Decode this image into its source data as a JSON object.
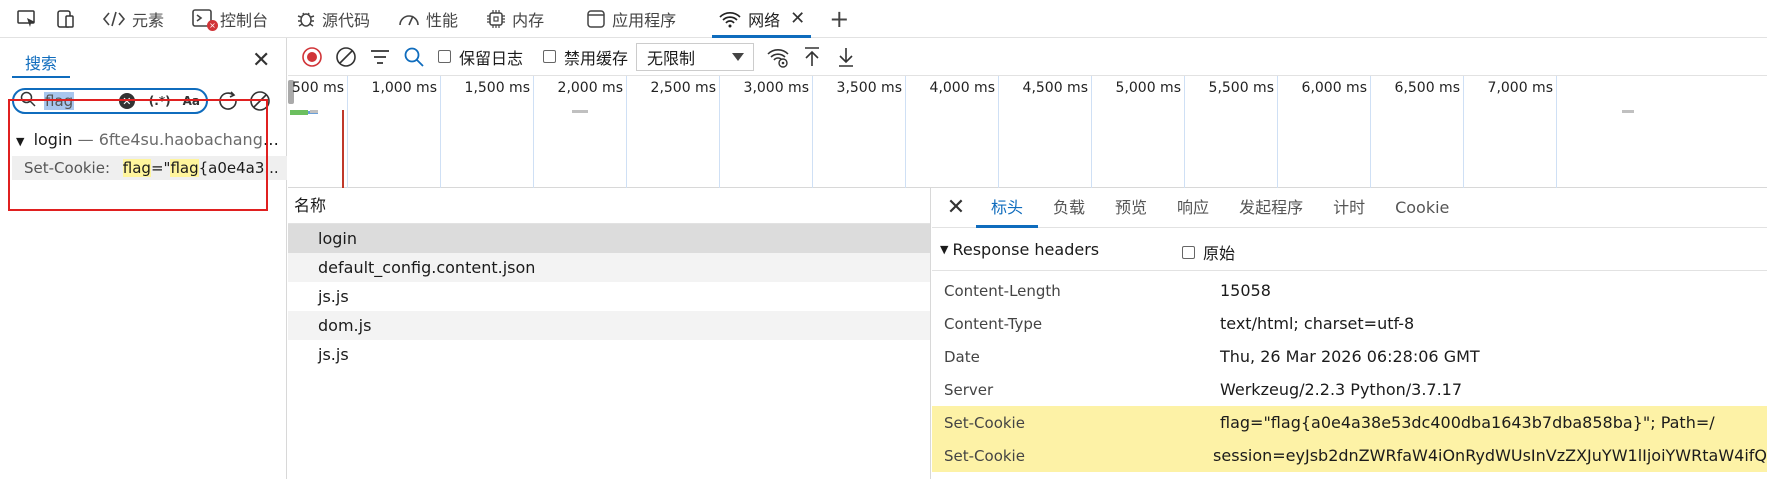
{
  "tabs": [
    {
      "label": "元素",
      "icon": "code-icon"
    },
    {
      "label": "控制台",
      "icon": "console-icon"
    },
    {
      "label": "源代码",
      "icon": "bug-icon"
    },
    {
      "label": "性能",
      "icon": "gauge-icon"
    },
    {
      "label": "内存",
      "icon": "chip-icon"
    },
    {
      "label": "应用程序",
      "icon": "app-icon"
    },
    {
      "label": "网络",
      "icon": "wifi-icon",
      "active": true
    }
  ],
  "search_panel": {
    "tab_label": "搜索",
    "query": "flag",
    "regex_label": "(.*)",
    "case_label": "Aa",
    "result_file": "login",
    "result_separator": " — ",
    "result_domain": "6fte4su.haobachang2...",
    "result_line_key": "Set-Cookie:",
    "result_line_hl1": "flag",
    "result_line_mid": "=\"",
    "result_line_hl2": "flag",
    "result_line_rest": "{a0e4a3..."
  },
  "toolbar": {
    "preserve_log": "保留日志",
    "disable_cache": "禁用缓存",
    "throttle": "无限制"
  },
  "timeline_ticks": [
    "500 ms",
    "1,000 ms",
    "1,500 ms",
    "2,000 ms",
    "2,500 ms",
    "3,000 ms",
    "3,500 ms",
    "4,000 ms",
    "4,500 ms",
    "5,000 ms",
    "5,500 ms",
    "6,000 ms",
    "6,500 ms",
    "7,000 ms"
  ],
  "names": {
    "header": "名称",
    "rows": [
      "login",
      "default_config.content.json",
      "js.js",
      "dom.js",
      "js.js"
    ]
  },
  "detail": {
    "tabs": [
      "标头",
      "负载",
      "预览",
      "响应",
      "发起程序",
      "计时",
      "Cookie"
    ],
    "section": "Response headers",
    "raw_label": "原始",
    "headers": [
      {
        "key": "Content-Length",
        "value": "15058"
      },
      {
        "key": "Content-Type",
        "value": "text/html; charset=utf-8"
      },
      {
        "key": "Date",
        "value": "Thu, 26 Mar 2026 06:28:06 GMT"
      },
      {
        "key": "Server",
        "value": "Werkzeug/2.2.3 Python/3.7.17"
      },
      {
        "key": "Set-Cookie",
        "value": "flag=\"flag{a0e4a38e53dc400dba1643b7dba858ba}\"; Path=/",
        "highlight": true
      },
      {
        "key": "Set-Cookie",
        "value": "session=eyJsb2dnZWRfaW4iOnRydWUsInVzZXJuYW1lIjoiYWRtaW4ifQ",
        "highlight": true
      }
    ]
  },
  "colors": {
    "accent": "#0f6cbd",
    "highlight": "#fdf2a6",
    "annotation": "#e02020"
  }
}
